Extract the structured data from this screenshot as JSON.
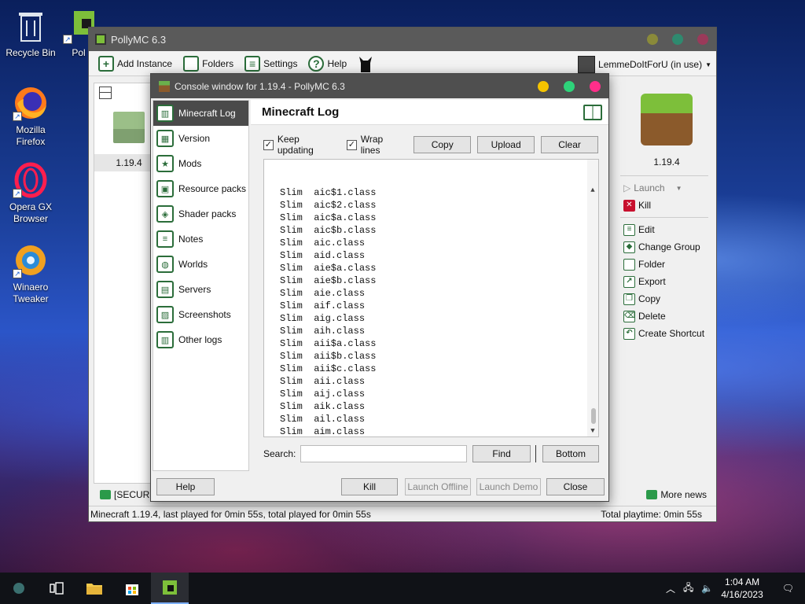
{
  "desktop": {
    "icons": [
      {
        "label": "Recycle Bin"
      },
      {
        "label": "Pol"
      },
      {
        "label": "Mozilla Firefox"
      },
      {
        "label": "Opera GX Browser"
      },
      {
        "label": "Winaero Tweaker"
      }
    ]
  },
  "main_window": {
    "title": "PollyMC 6.3",
    "toolbar": {
      "add_instance": "Add Instance",
      "folders": "Folders",
      "settings": "Settings",
      "help": "Help"
    },
    "account": "LemmeDoItForU (in use)",
    "instance_label": "1.19.4",
    "right_panel": {
      "instance_name": "1.19.4",
      "launch": "Launch",
      "kill": "Kill",
      "edit": "Edit",
      "change_group": "Change Group",
      "folder": "Folder",
      "export": "Export",
      "copy": "Copy",
      "delete": "Delete",
      "create_shortcut": "Create Shortcut"
    },
    "news_left": "[SECURIT",
    "more_news": "More news",
    "status_left": "Minecraft 1.19.4, last played for 0min 55s, total played for 0min 55s",
    "status_right": "Total playtime: 0min 55s",
    "colors": {
      "titlebar": "#5a5a5a",
      "accent_green": "#2b6d3a"
    }
  },
  "console": {
    "title": "Console window for 1.19.4 - PollyMC 6.3",
    "nav": [
      {
        "label": "Minecraft Log",
        "icon": "book-icon"
      },
      {
        "label": "Version",
        "icon": "grass-block-icon"
      },
      {
        "label": "Mods",
        "icon": "star-icon"
      },
      {
        "label": "Resource packs",
        "icon": "resource-pack-icon"
      },
      {
        "label": "Shader packs",
        "icon": "cube-icon"
      },
      {
        "label": "Notes",
        "icon": "notes-icon"
      },
      {
        "label": "Worlds",
        "icon": "globe-icon"
      },
      {
        "label": "Servers",
        "icon": "server-icon"
      },
      {
        "label": "Screenshots",
        "icon": "picture-icon"
      },
      {
        "label": "Other logs",
        "icon": "book-icon"
      }
    ],
    "page_title": "Minecraft Log",
    "keep_updating": "Keep updating",
    "wrap_lines": "Wrap lines",
    "copy": "Copy",
    "upload": "Upload",
    "clear": "Clear",
    "log_lines": [
      "Slim  aic$1.class",
      "Slim  aic$2.class",
      "Slim  aic$a.class",
      "Slim  aic$b.class",
      "Slim  aic.class",
      "Slim  aid.class",
      "Slim  aie$a.class",
      "Slim  aie$b.class",
      "Slim  aie.class",
      "Slim  aif.class",
      "Slim  aig.class",
      "Slim  aih.class",
      "Slim  aii$a.class",
      "Slim  aii$b.class",
      "Slim  aii$c.class",
      "Slim  aii.class",
      "Slim  aij.class",
      "Slim  aik.class",
      "Slim  ail.class",
      "Slim  aim.class"
    ],
    "search_label": "Search:",
    "search_value": "",
    "find": "Find",
    "bottom": "Bottom",
    "help": "Help",
    "kill": "Kill",
    "launch_offline": "Launch Offline",
    "launch_demo": "Launch Demo",
    "close": "Close"
  },
  "taskbar": {
    "time": "1:04 AM",
    "date": "4/16/2023"
  }
}
